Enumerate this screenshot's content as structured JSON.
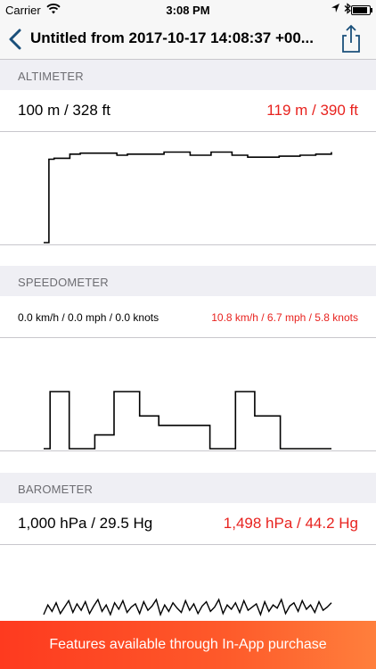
{
  "status_bar": {
    "carrier": "Carrier",
    "time": "3:08 PM",
    "battery_level": 0.9,
    "icons": [
      "wifi-icon",
      "location-arrow-icon",
      "bluetooth-icon",
      "battery-icon"
    ]
  },
  "nav": {
    "title": "Untitled from 2017-10-17 14:08:37 +00...",
    "icons": [
      "chevron-left-icon",
      "share-icon"
    ]
  },
  "sections": {
    "altimeter": {
      "header": "ALTIMETER",
      "current": "100 m / 328 ft",
      "max": "119 m / 390 ft",
      "chart": [
        0,
        82,
        83,
        83,
        83,
        87,
        87,
        88,
        88,
        88,
        88,
        88,
        88,
        88,
        86,
        86,
        87,
        87,
        87,
        87,
        87,
        87,
        87,
        89,
        89,
        89,
        89,
        89,
        86,
        86,
        86,
        86,
        89,
        89,
        89,
        89,
        86,
        86,
        86,
        84,
        84,
        84,
        84,
        84,
        84,
        85,
        85,
        85,
        85,
        86,
        86,
        86,
        87,
        87,
        87,
        89
      ]
    },
    "speedometer": {
      "header": "SPEEDOMETER",
      "current": "0.0 km/h / 0.0 mph / 0.0 knots",
      "max": "10.8 km/h / 6.7 mph / 5.8 knots",
      "chart": [
        0,
        10.8,
        10.8,
        10.8,
        0,
        0,
        0,
        0,
        2.6,
        2.6,
        2.6,
        10.8,
        10.8,
        10.8,
        10.8,
        6.2,
        6.2,
        6.2,
        4.4,
        4.4,
        4.4,
        4.4,
        4.4,
        4.4,
        4.4,
        4.4,
        0,
        0,
        0,
        0,
        10.8,
        10.8,
        10.8,
        6.2,
        6.2,
        6.2,
        6.2,
        0,
        0,
        0,
        0,
        0,
        0,
        0,
        0,
        0
      ]
    },
    "barometer": {
      "header": "BAROMETER",
      "current": "1,000 hPa / 29.5 Hg",
      "max": "1,498 hPa / 44.2 Hg",
      "chart": [
        5,
        14,
        8,
        16,
        6,
        12,
        18,
        7,
        15,
        9,
        17,
        6,
        13,
        19,
        8,
        14,
        5,
        16,
        10,
        18,
        7,
        12,
        15,
        6,
        17,
        9,
        13,
        19,
        5,
        14,
        8,
        16,
        11,
        7,
        18,
        9,
        15,
        6,
        13,
        17,
        8,
        12,
        19,
        6,
        14,
        10,
        16,
        7,
        18,
        9,
        12,
        15,
        5,
        17,
        8,
        14,
        11,
        19,
        6,
        13,
        16,
        8,
        18,
        10,
        14,
        7,
        17,
        9,
        12,
        16
      ]
    }
  },
  "banner": {
    "label": "Features available through In-App purchase"
  }
}
